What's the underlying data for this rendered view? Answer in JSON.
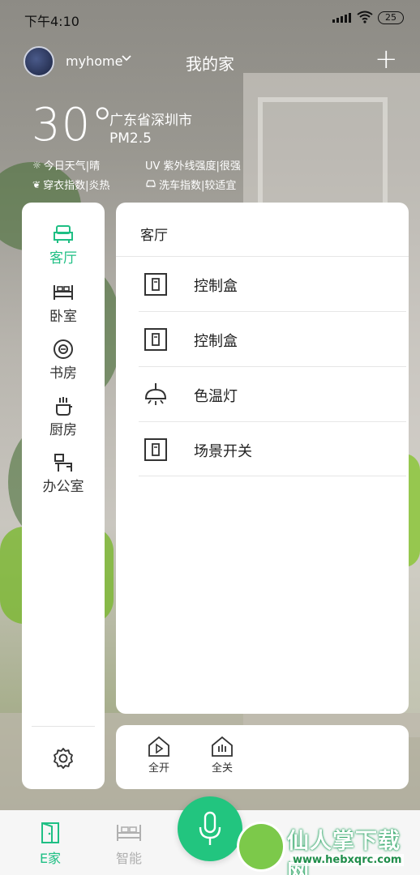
{
  "status_bar": {
    "time": "下午4:10",
    "battery": "25"
  },
  "header": {
    "username": "myhome",
    "title": "我的家",
    "add_label": "+"
  },
  "weather": {
    "temperature": "30°",
    "location": "广东省深圳市",
    "pm25": "PM2.5",
    "today": "今日天气|晴",
    "uv": "UV 紫外线强度|很强",
    "dressing": "穿衣指数|炎热",
    "carwash": "洗车指数|较适宜"
  },
  "rooms": [
    {
      "label": "客厅",
      "icon": "sofa-icon",
      "active": true
    },
    {
      "label": "卧室",
      "icon": "bed-icon",
      "active": false
    },
    {
      "label": "书房",
      "icon": "study-icon",
      "active": false
    },
    {
      "label": "厨房",
      "icon": "kitchen-icon",
      "active": false
    },
    {
      "label": "办公室",
      "icon": "office-icon",
      "active": false
    }
  ],
  "room_panel": {
    "title": "客厅",
    "devices": [
      {
        "name": "控制盒",
        "icon": "switch-box-icon"
      },
      {
        "name": "控制盒",
        "icon": "switch-box-icon"
      },
      {
        "name": "色温灯",
        "icon": "ceiling-lamp-icon"
      },
      {
        "name": "场景开关",
        "icon": "switch-box-icon"
      }
    ]
  },
  "quick_actions": {
    "all_on": "全开",
    "all_off": "全关"
  },
  "tabs": [
    {
      "label": "E家",
      "icon": "door-icon",
      "active": true
    },
    {
      "label": "智能",
      "icon": "bed-icon",
      "active": false
    }
  ],
  "watermark": {
    "text": "仙人掌下载网",
    "url": "www.hebxqrc.com"
  },
  "colors": {
    "accent": "#1fbf84",
    "mic": "#22c57f"
  }
}
